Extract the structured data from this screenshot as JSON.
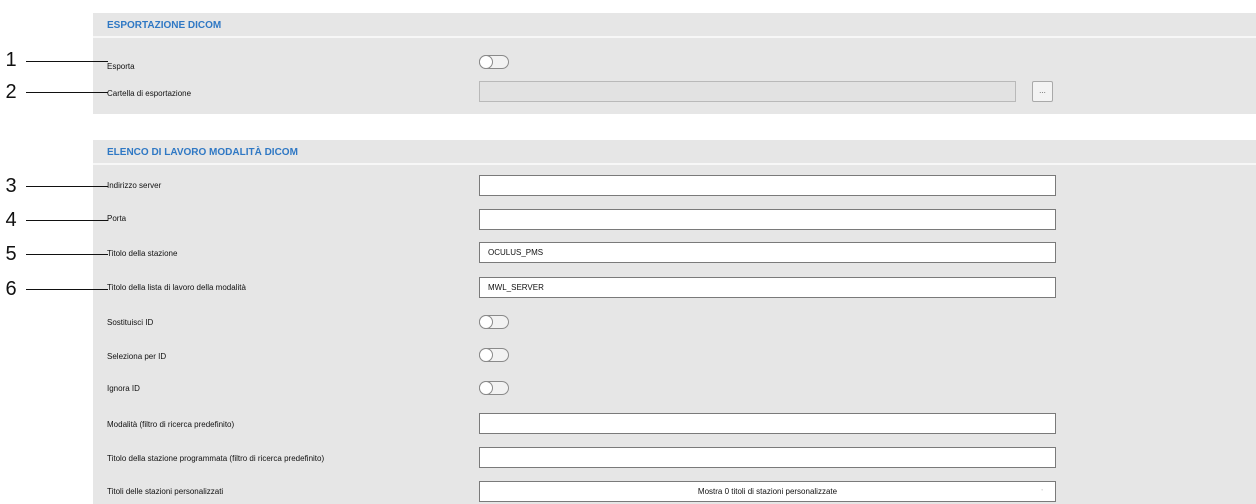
{
  "export_section": {
    "title": "ESPORTAZIONE DICOM",
    "export_label": "Esporta",
    "export_toggle_on": false,
    "folder_label": "Cartella di esportazione",
    "folder_value": "",
    "browse_label": "..."
  },
  "worklist_section": {
    "title": "ELENCO DI LAVORO MODALITÀ DICOM",
    "server_address_label": "Indirizzo server",
    "server_address_value": "",
    "port_label": "Porta",
    "port_value": "",
    "station_title_label": "Titolo della stazione",
    "station_title_value": "OCULUS_PMS",
    "modality_worklist_title_label": "Titolo della lista di lavoro della modalità",
    "modality_worklist_title_value": "MWL_SERVER",
    "replace_id_label": "Sostituisci ID",
    "replace_id_on": false,
    "select_by_id_label": "Seleziona per ID",
    "select_by_id_on": false,
    "ignore_id_label": "Ignora ID",
    "ignore_id_on": false,
    "modality_filter_label": "Modalità (filtro di ricerca predefinito)",
    "modality_filter_value": "",
    "scheduled_station_title_label": "Titolo della stazione programmata (filtro di ricerca predefinito)",
    "scheduled_station_title_value": "",
    "custom_station_titles_label": "Titoli delle stazioni personalizzati",
    "custom_station_titles_value": "Mostra 0 titoli di stazioni personalizzate"
  },
  "callouts": [
    "1",
    "2",
    "3",
    "4",
    "5",
    "6"
  ]
}
